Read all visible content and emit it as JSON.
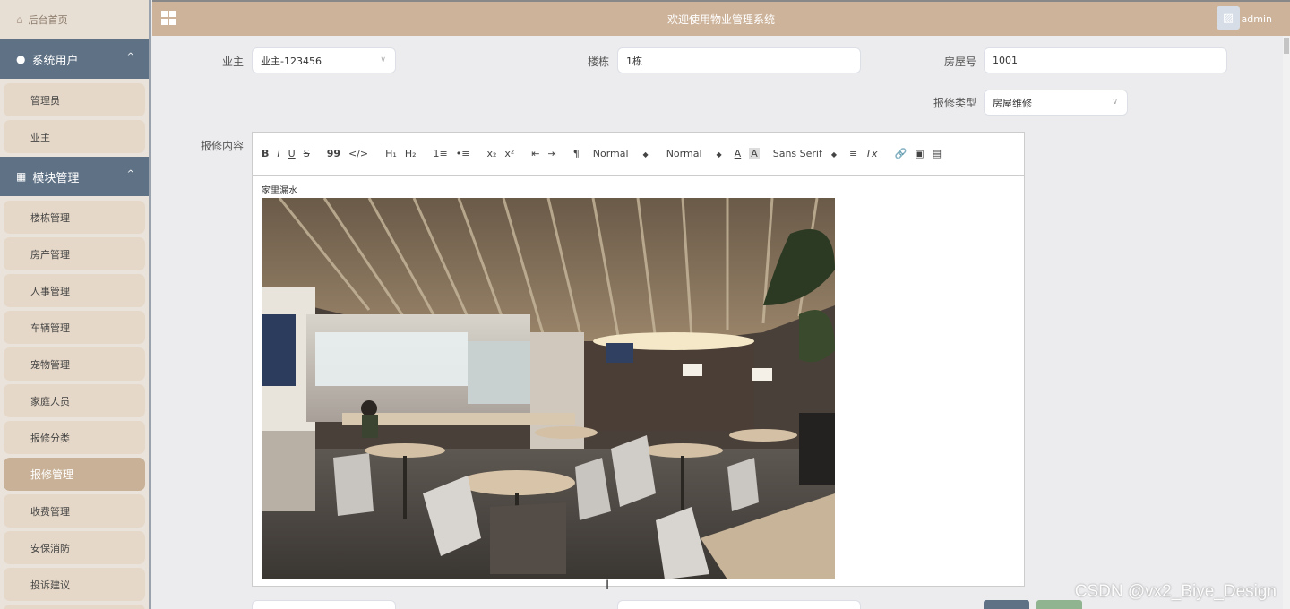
{
  "sidebar": {
    "home_label": "后台首页",
    "groups": [
      {
        "label": "系统用户",
        "items": [
          "管理员",
          "业主"
        ]
      },
      {
        "label": "模块管理",
        "items": [
          "楼栋管理",
          "房产管理",
          "人事管理",
          "车辆管理",
          "宠物管理",
          "家庭人员",
          "报修分类",
          "报修管理",
          "收费管理",
          "安保消防",
          "投诉建议"
        ]
      }
    ],
    "active_item": "报修管理"
  },
  "header": {
    "title": "欢迎使用物业管理系统",
    "username": "admin"
  },
  "form": {
    "owner_label": "业主",
    "owner_value": "业主-123456",
    "building_label": "楼栋",
    "building_value": "1栋",
    "room_label": "房屋号",
    "room_value": "1001",
    "repair_type_label": "报修类型",
    "repair_type_value": "房屋维修",
    "content_label": "报修内容",
    "content_text": "家里漏水"
  },
  "editor_toolbar": {
    "bold": "B",
    "italic": "I",
    "underline": "U",
    "strike": "S",
    "quote": "99",
    "code": "</>",
    "h1": "H₁",
    "h2": "H₂",
    "ordered_list": "1≡",
    "bullet_list": "•≡",
    "sub": "x₂",
    "sup": "x²",
    "outdent": "⇤",
    "indent": "⇥",
    "direction": "¶",
    "size_select": "Normal",
    "header_select": "Normal",
    "font_color": "A",
    "background": "A",
    "font_select": "Sans Serif",
    "align": "≡",
    "clean": "Tx",
    "link": "🔗",
    "image": "▣",
    "video": "▤"
  },
  "watermark": "CSDN @vx2_Biye_Design",
  "colors": {
    "header": "#cdb39a",
    "sidebar_group": "#5e7185",
    "menu_item": "#e6d8c8",
    "menu_active": "#c8b196"
  }
}
